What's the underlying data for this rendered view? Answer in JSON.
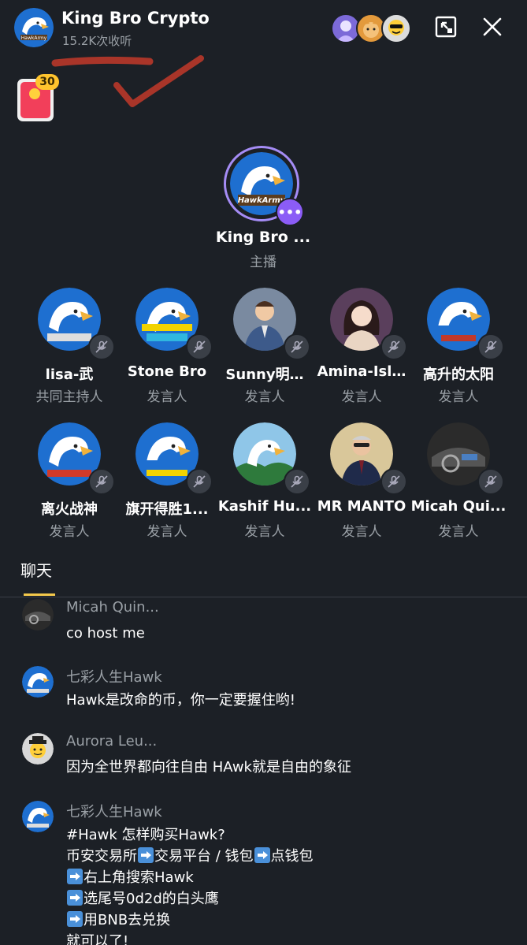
{
  "header": {
    "title": "King Bro Crypto",
    "listens": "15.2K次收听",
    "minimize_icon": "minimize-window-icon",
    "close_icon": "close-icon"
  },
  "red_packet": {
    "count": "30"
  },
  "host": {
    "name": "King Bro ...",
    "role": "主播"
  },
  "speakers": [
    {
      "name": "lisa-武",
      "role": "共同主持人",
      "avatar": "eagle"
    },
    {
      "name": "Stone Bro",
      "role": "发言人",
      "avatar": "eagle"
    },
    {
      "name": "Sunny明…",
      "role": "发言人",
      "avatar": "man-suit"
    },
    {
      "name": "Amina-Isl…",
      "role": "发言人",
      "avatar": "woman"
    },
    {
      "name": "高升的太阳",
      "role": "发言人",
      "avatar": "eagle"
    },
    {
      "name": "离火战神",
      "role": "发言人",
      "avatar": "eagle"
    },
    {
      "name": "旗开得胜1...",
      "role": "发言人",
      "avatar": "eagle"
    },
    {
      "name": "Kashif Hu...",
      "role": "发言人",
      "avatar": "eagle-landscape"
    },
    {
      "name": "MR MANTO",
      "role": "发言人",
      "avatar": "man-glasses"
    },
    {
      "name": "Micah Qui...",
      "role": "发言人",
      "avatar": "car-interior"
    }
  ],
  "chat": {
    "tab_label": "聊天",
    "messages": [
      {
        "user": "Micah Quin...",
        "lines": [
          "co host me"
        ]
      },
      {
        "user": "七彩人生Hawk",
        "lines": [
          "Hawk是改命的币，你一定要握住哟!"
        ]
      },
      {
        "user": "Aurora Leu...",
        "lines": [
          "因为全世界都向往自由 HAwk就是自由的象征"
        ]
      },
      {
        "user": "七彩人生Hawk",
        "lines": [
          "#Hawk 怎样购买Hawk?",
          "币安交易所",
          "交易平台 / 钱包",
          "点钱包",
          "右上角搜索Hawk",
          "选尾号0d2d的白头鹰",
          "用BNB去兑换",
          "就可以了!"
        ]
      }
    ]
  },
  "colors": {
    "background": "#1c2026",
    "muted_text": "#9aa0a6",
    "accent_purple": "#8b5cf6",
    "tab_underline": "#f3c84b"
  }
}
